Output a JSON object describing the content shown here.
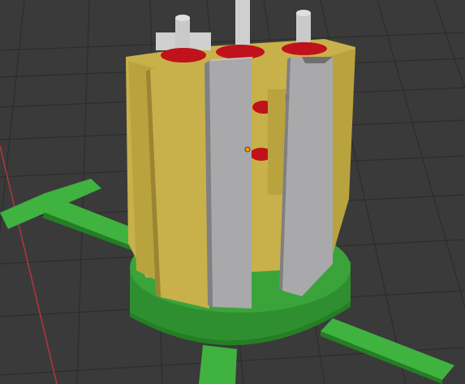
{
  "viewport": {
    "background": "#3a3a3a",
    "grid_color": "#2d2d2d",
    "x_axis_color": "#b3363e"
  },
  "scene": {
    "base_color": "#3aa43a",
    "base_shadow_color": "#237f24",
    "arm_color": "#3fb23f",
    "gold_panel_color": "#c8b14b",
    "gold_shadow_color": "#9a8532",
    "gray_panel_color": "#a9a9ab",
    "gray_shadow_color": "#808083",
    "red_ring_color": "#c0121b",
    "purple_gear_color": "#9b2fbf",
    "origin_dot_color": "#ff9c00"
  }
}
